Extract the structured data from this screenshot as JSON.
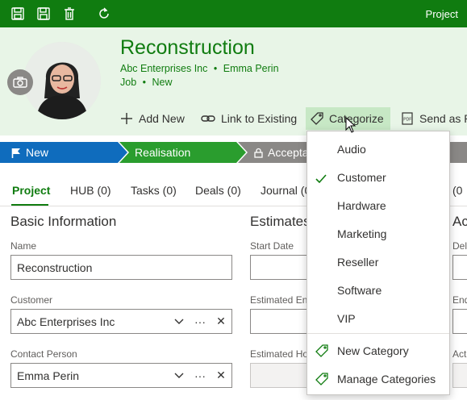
{
  "topbar": {
    "module": "Project",
    "icons": [
      "save-close-icon",
      "save-icon",
      "delete-icon",
      "refresh-icon"
    ],
    "background": "#107c10"
  },
  "header": {
    "title": "Reconstruction",
    "customer": "Abc Enterprises Inc",
    "separator": "•",
    "contact": "Emma Perin",
    "type": "Job",
    "status": "New"
  },
  "actions": {
    "add_new": "Add New",
    "link_existing": "Link to Existing",
    "categorize": "Categorize",
    "send_as": "Send as P"
  },
  "process": {
    "stages": [
      "New",
      "Realisation",
      "Accepta"
    ],
    "colors": {
      "new": "#0f6cbd",
      "realisation": "#2a9d2e",
      "future": "#8a8886"
    }
  },
  "tabs": [
    "Project",
    "HUB (0)",
    "Tasks (0)",
    "Deals (0)",
    "Journal (0",
    "(0"
  ],
  "basic": {
    "heading": "Basic Information",
    "name_label": "Name",
    "name_value": "Reconstruction",
    "customer_label": "Customer",
    "customer_value": "Abc Enterprises Inc",
    "contact_label": "Contact Person",
    "contact_value": "Emma Perin",
    "more": "···",
    "clear": "✕"
  },
  "estimates": {
    "heading": "Estimates",
    "start_label": "Start Date",
    "end_label": "Estimated En",
    "hours_label": "Estimated Ho"
  },
  "right_col": {
    "heading": "Ac",
    "l1": "Del",
    "l2": "End",
    "l3": "Act"
  },
  "menu": {
    "items": [
      "Audio",
      "Customer",
      "Hardware",
      "Marketing",
      "Reseller",
      "Software",
      "VIP"
    ],
    "checked": "Customer",
    "new_category": "New Category",
    "manage_categories": "Manage Categories"
  }
}
